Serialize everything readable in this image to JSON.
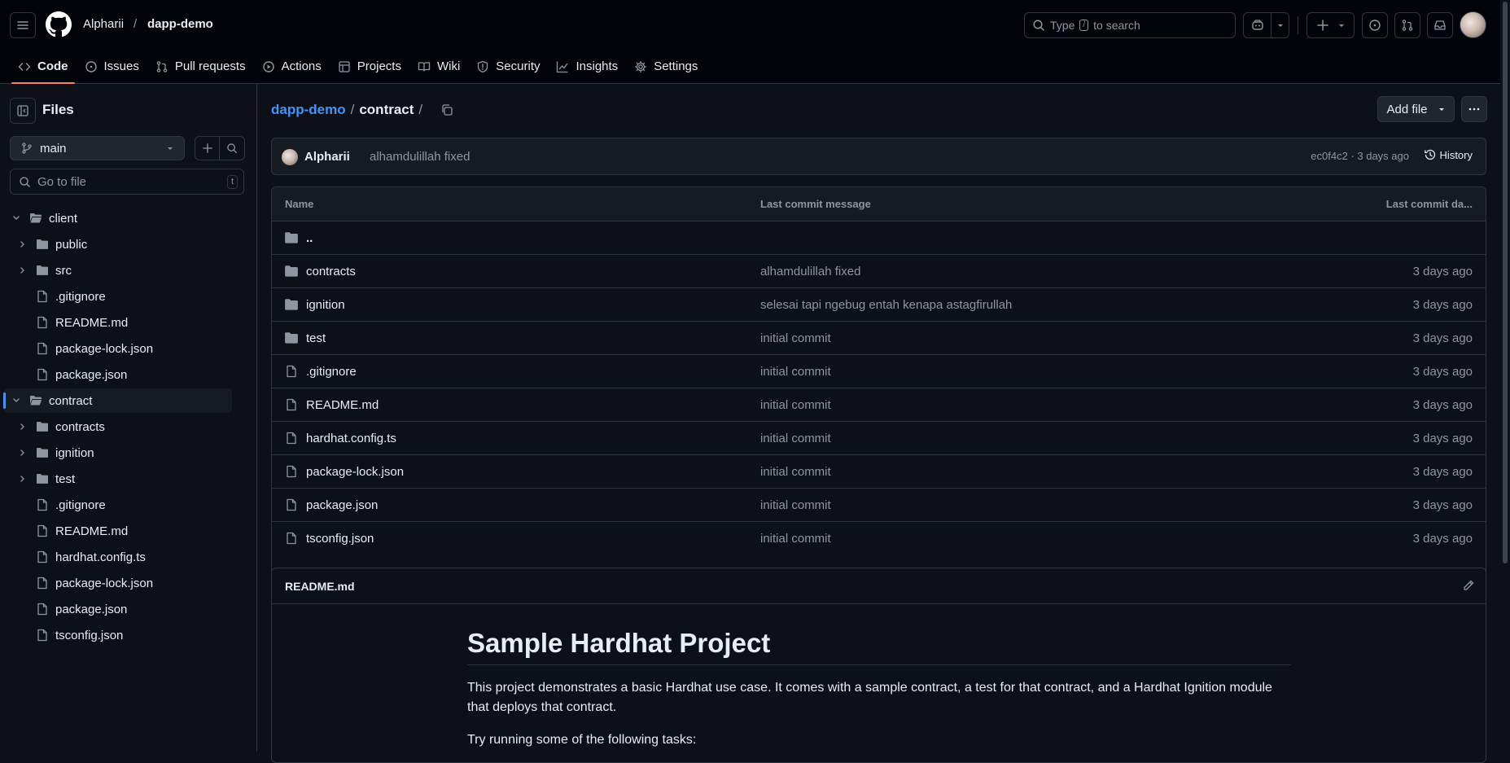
{
  "header": {
    "owner": "Alpharii",
    "separator": "/",
    "repo": "dapp-demo",
    "search_prefix": "Type",
    "search_key": "/",
    "search_suffix": "to search"
  },
  "nav_tabs": [
    {
      "label": "Code",
      "icon": "code-icon"
    },
    {
      "label": "Issues",
      "icon": "issue-icon"
    },
    {
      "label": "Pull requests",
      "icon": "pull-request-icon"
    },
    {
      "label": "Actions",
      "icon": "play-icon"
    },
    {
      "label": "Projects",
      "icon": "table-icon"
    },
    {
      "label": "Wiki",
      "icon": "book-icon"
    },
    {
      "label": "Security",
      "icon": "shield-icon"
    },
    {
      "label": "Insights",
      "icon": "graph-icon"
    },
    {
      "label": "Settings",
      "icon": "gear-icon"
    }
  ],
  "sidebar": {
    "title": "Files",
    "branch": "main",
    "go_to_file_placeholder": "Go to file",
    "go_to_file_shortcut": "t",
    "tree": [
      {
        "label": "client",
        "type": "folder-open"
      },
      {
        "label": "public",
        "type": "folder"
      },
      {
        "label": "src",
        "type": "folder"
      },
      {
        "label": ".gitignore",
        "type": "file"
      },
      {
        "label": "README.md",
        "type": "file"
      },
      {
        "label": "package-lock.json",
        "type": "file"
      },
      {
        "label": "package.json",
        "type": "file"
      },
      {
        "label": "contract",
        "type": "folder-open"
      },
      {
        "label": "contracts",
        "type": "folder"
      },
      {
        "label": "ignition",
        "type": "folder"
      },
      {
        "label": "test",
        "type": "folder"
      },
      {
        "label": ".gitignore",
        "type": "file"
      },
      {
        "label": "README.md",
        "type": "file"
      },
      {
        "label": "hardhat.config.ts",
        "type": "file"
      },
      {
        "label": "package-lock.json",
        "type": "file"
      },
      {
        "label": "package.json",
        "type": "file"
      },
      {
        "label": "tsconfig.json",
        "type": "file"
      }
    ]
  },
  "breadcrumb": {
    "repo": "dapp-demo",
    "sep1": "/",
    "folder": "contract",
    "sep2": "/"
  },
  "actions": {
    "add_file": "Add file"
  },
  "commit": {
    "author": "Alpharii",
    "message": "alhamdulillah fixed",
    "meta": "ec0f4c2 · 3 days ago",
    "history": "History"
  },
  "table": {
    "headers": [
      "Name",
      "Last commit message",
      "Last commit da..."
    ],
    "parent": "..",
    "rows": [
      {
        "name": "contracts",
        "type": "folder",
        "message": "alhamdulillah fixed",
        "date": "3 days ago"
      },
      {
        "name": "ignition",
        "type": "folder",
        "message": "selesai tapi ngebug entah kenapa astagfirullah",
        "date": "3 days ago"
      },
      {
        "name": "test",
        "type": "folder",
        "message": "initial commit",
        "date": "3 days ago"
      },
      {
        "name": ".gitignore",
        "type": "file",
        "message": "initial commit",
        "date": "3 days ago"
      },
      {
        "name": "README.md",
        "type": "file",
        "message": "initial commit",
        "date": "3 days ago"
      },
      {
        "name": "hardhat.config.ts",
        "type": "file",
        "message": "initial commit",
        "date": "3 days ago"
      },
      {
        "name": "package-lock.json",
        "type": "file",
        "message": "initial commit",
        "date": "3 days ago"
      },
      {
        "name": "package.json",
        "type": "file",
        "message": "initial commit",
        "date": "3 days ago"
      },
      {
        "name": "tsconfig.json",
        "type": "file",
        "message": "initial commit",
        "date": "3 days ago"
      }
    ]
  },
  "readme": {
    "filename": "README.md",
    "title": "Sample Hardhat Project",
    "paragraph": "This project demonstrates a basic Hardhat use case. It comes with a sample contract, a test for that contract, and a Hardhat Ignition module that deploys that contract.",
    "paragraph2": "Try running some of the following tasks:"
  },
  "colors": {
    "accent": "#4493f8",
    "tab_underline": "#f78166",
    "background": "#0d1117",
    "border": "#30363d"
  }
}
